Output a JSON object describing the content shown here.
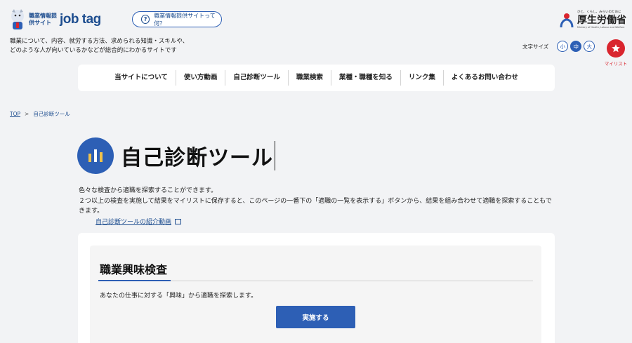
{
  "header": {
    "logo_small": "職業情報提供サイト",
    "logo_main": "job tag",
    "about_label": "職業情報提供サイトって何？",
    "tagline_1": "職業について、内容、就労する方法、求められる知識・スキルや、",
    "tagline_2": "どのような人が向いているかなどが総合的にわかるサイトです",
    "ministry_sub": "ひと、くらし、みらいのために",
    "ministry_name": "厚生労働省",
    "ministry_en": "Ministry of Health, Labour and Welfare",
    "fontsize_label": "文字サイズ",
    "fontsize_small": "小",
    "fontsize_medium": "中",
    "fontsize_large": "大",
    "mylist_label": "マイリスト"
  },
  "nav": {
    "items": [
      {
        "label": "当サイトについて"
      },
      {
        "label": "使い方動画"
      },
      {
        "label": "自己診断ツール"
      },
      {
        "label": "職業検索"
      },
      {
        "label": "業種・職種を知る"
      },
      {
        "label": "リンク集"
      },
      {
        "label": "よくあるお問い合わせ"
      }
    ]
  },
  "breadcrumb": {
    "home": "TOP",
    "separator": ">",
    "current": "自己診断ツール"
  },
  "main": {
    "title": "自己診断ツール",
    "desc_1": "色々な検査から適職を探索することができます。",
    "desc_2": "２つ以上の検査を実施して結果をマイリストに保存すると、このページの一番下の「適職の一覧を表示する」ボタンから、結果を組み合わせて適職を探索することもできます。",
    "intro_link": "自己診断ツールの紹介動画",
    "card": {
      "title": "職業興味検査",
      "desc": "あなたの仕事に対する「興味」から適職を探索します。",
      "button": "実施する"
    }
  },
  "colors": {
    "accent": "#2d5fb5",
    "brand_red": "#d9252e",
    "background": "#f2f3f5"
  }
}
